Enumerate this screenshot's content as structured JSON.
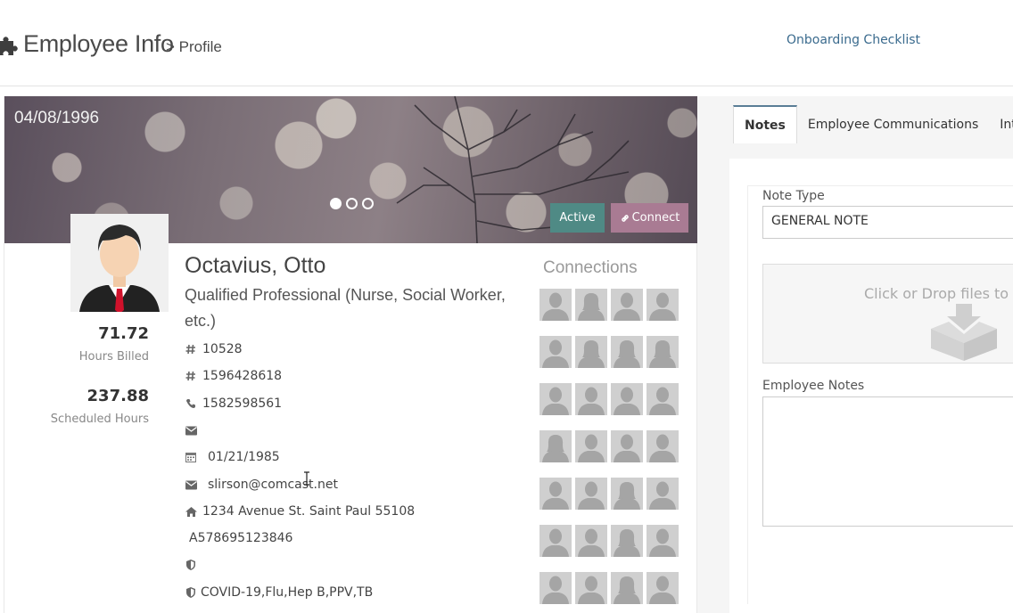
{
  "header": {
    "title": "Employee Info",
    "subtitle": "> Profile",
    "checklist_link": "Onboarding Checklist"
  },
  "banner": {
    "date": "04/08/1996",
    "status_button": "Active",
    "connect_button": "Connect",
    "carousel_pages": 3,
    "carousel_active": 1
  },
  "employee": {
    "name": "Octavius, Otto",
    "role": "Qualified Professional (Nurse, Social Worker, etc.)",
    "hours_billed": "71.72",
    "hours_billed_label": "Hours Billed",
    "scheduled_hours": "237.88",
    "scheduled_hours_label": "Scheduled Hours",
    "id_1": "10528",
    "id_2": "1596428618",
    "phone": "1582598561",
    "email_1": "",
    "dob": "01/21/1985",
    "email_2": "slirson@comcast.net",
    "address": "1234 Avenue St. Saint Paul 55108",
    "license": "A578695123846",
    "shield_1": "",
    "vaccines": "COVID-19,Flu,Hep B,PPV,TB"
  },
  "connections": {
    "title": "Connections"
  },
  "tabs": [
    {
      "label": "Notes"
    },
    {
      "label": "Employee Communications"
    },
    {
      "label": "Inte"
    }
  ],
  "notes_form": {
    "note_type_label": "Note Type",
    "note_type_value": "GENERAL NOTE",
    "dropzone_text": "Click or Drop files to",
    "employee_notes_label": "Employee Notes",
    "employee_notes_value": ""
  },
  "colors": {
    "active_button": "#4f8a85",
    "connect_button": "#a97b93",
    "link": "#3b6b8e",
    "tab_accent": "#5a7d96"
  }
}
